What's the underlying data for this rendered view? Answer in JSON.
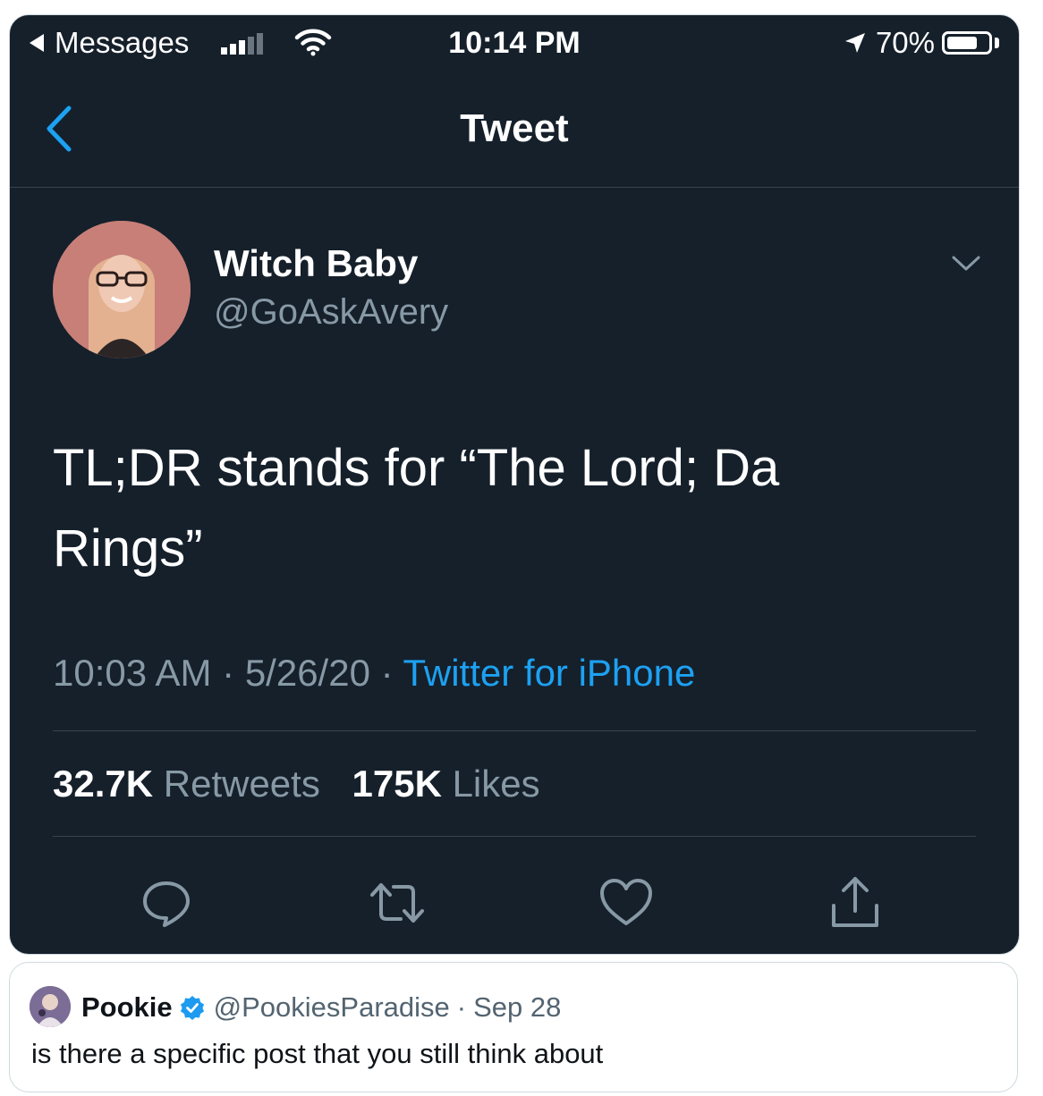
{
  "status_bar": {
    "back_app": "Messages",
    "time": "10:14 PM",
    "battery": "70%",
    "battery_level": 0.7,
    "signal_bars_filled": 3,
    "signal_bars_total": 5
  },
  "nav": {
    "title": "Tweet"
  },
  "tweet": {
    "author_name": "Witch Baby",
    "author_handle": "@GoAskAvery",
    "text_line1": "TL;DR stands for “The Lord; Da",
    "text_line2": "Rings”",
    "time": "10:03 AM",
    "date": "5/26/20",
    "separator": "·",
    "source": "Twitter for iPhone",
    "retweets_count": "32.7K",
    "retweets_label": "Retweets",
    "likes_count": "175K",
    "likes_label": "Likes"
  },
  "actions": [
    "reply-icon",
    "retweet-icon",
    "like-icon",
    "share-icon"
  ],
  "quote": {
    "name": "Pookie",
    "handle": "@PookiesParadise",
    "separator": "·",
    "date": "Sep 28",
    "text": "is there a specific post that you still think about"
  },
  "colors": {
    "background": "#15202b",
    "accent": "#1da1f2",
    "muted": "#8899a6",
    "verified": "#1d9bf0"
  }
}
